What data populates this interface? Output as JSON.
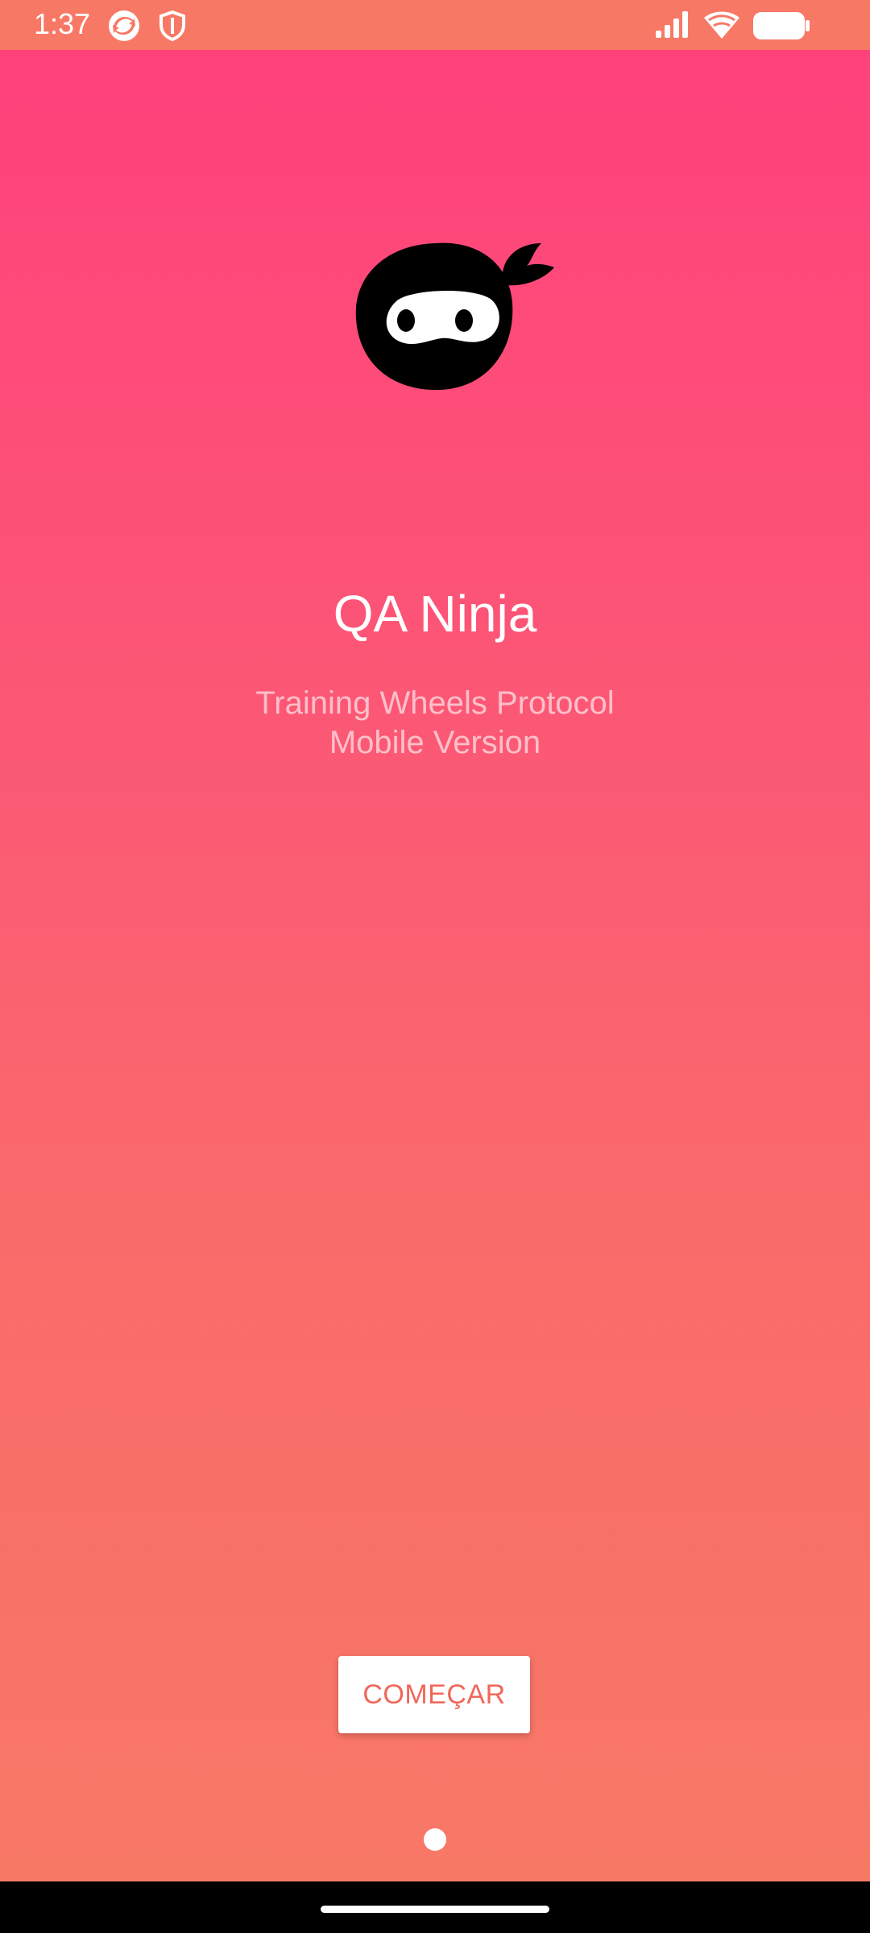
{
  "status_bar": {
    "time": "1:37",
    "left_icons": [
      "sync-app-icon",
      "shield-icon"
    ],
    "right_icons": [
      "signal-icon",
      "wifi-icon",
      "battery-icon"
    ]
  },
  "splash": {
    "logo_icon": "ninja-logo-icon",
    "title": "QA Ninja",
    "subtitle_line1": "Training Wheels Protocol",
    "subtitle_line2": "Mobile Version"
  },
  "actions": {
    "start_label": "COMEÇAR"
  },
  "pager": {
    "pages": 1,
    "active_index": 0
  },
  "colors": {
    "gradient_top": "#FF417C",
    "gradient_bottom": "#F87866",
    "button_text": "#F0675A",
    "status_bar": "#F87866",
    "nav_bar": "#000000"
  }
}
